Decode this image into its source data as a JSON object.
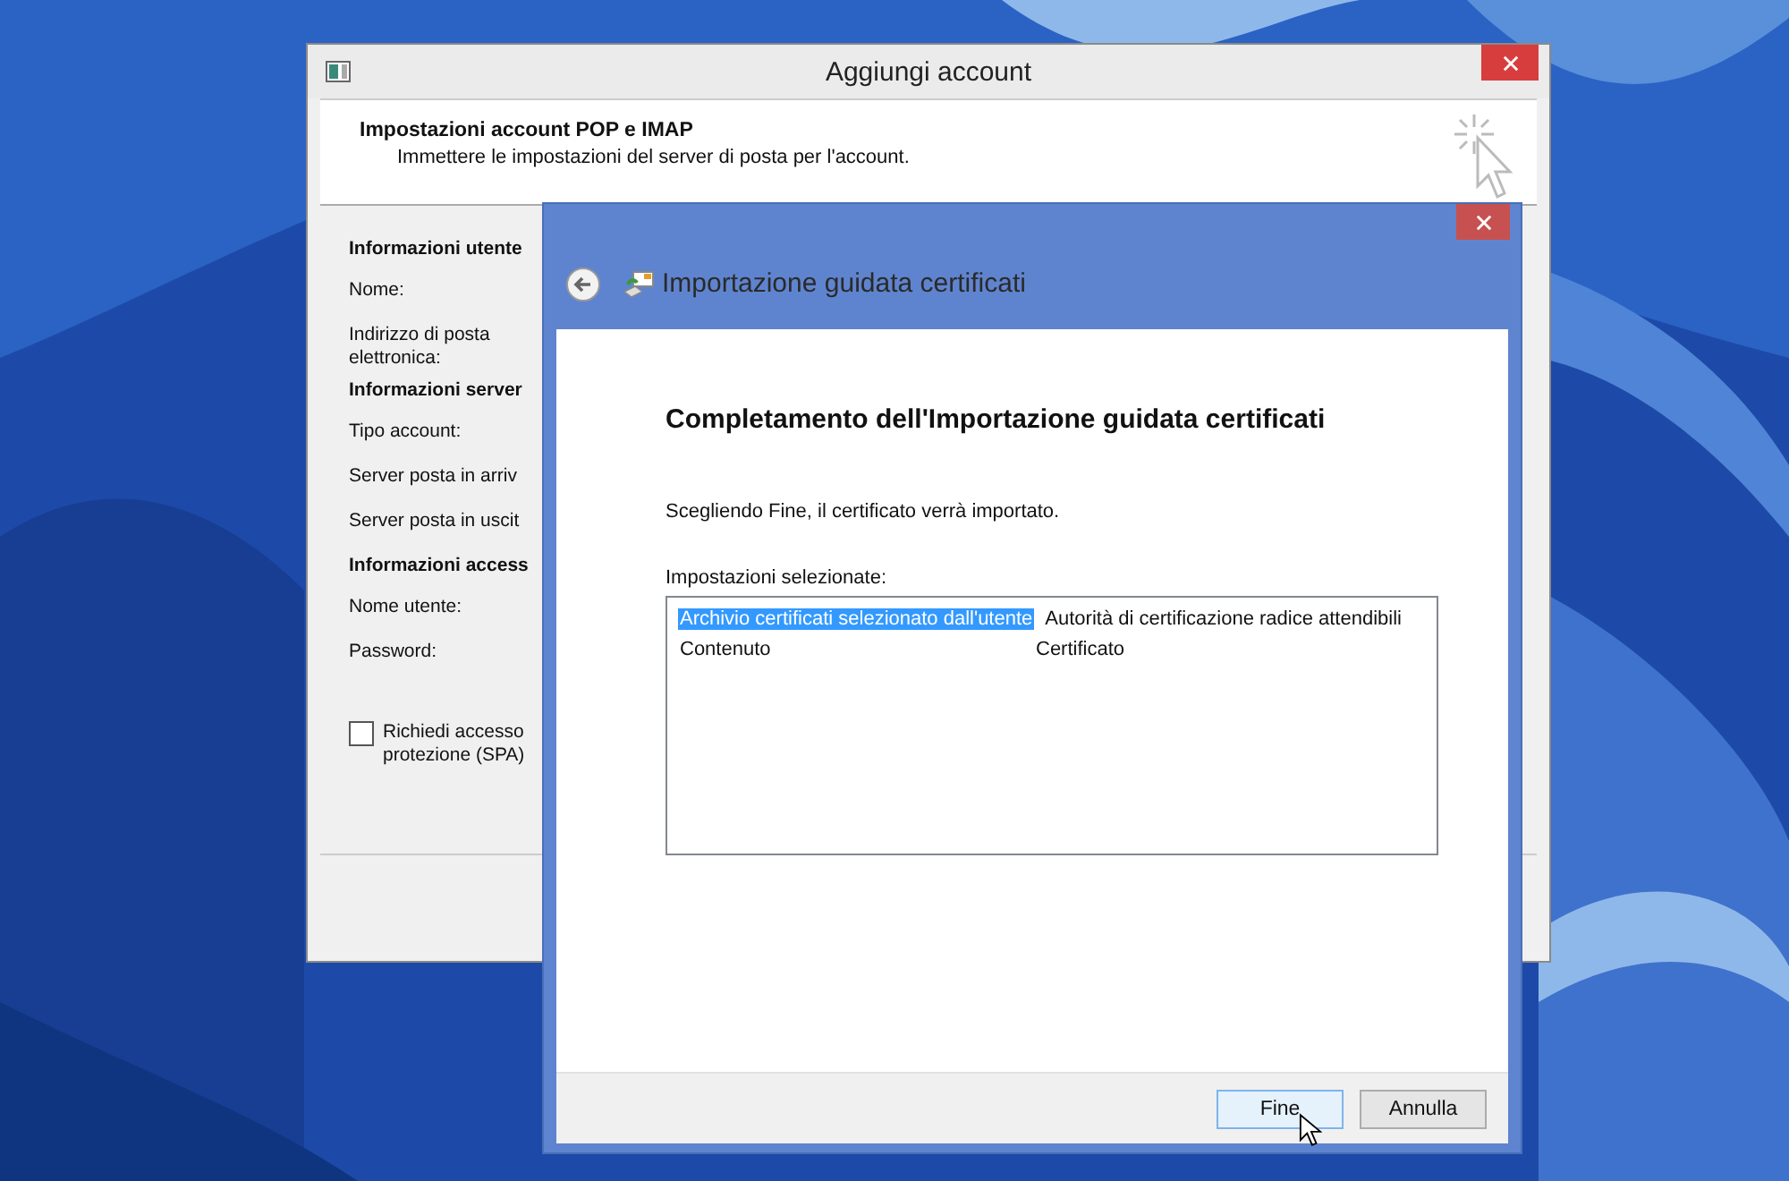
{
  "back_window": {
    "title": "Aggiungi account",
    "header": {
      "title": "Impostazioni account POP e IMAP",
      "subtitle": "Immettere le impostazioni del server di posta per l'account."
    },
    "sections": [
      {
        "heading": "Informazioni utente",
        "fields": [
          "Nome:",
          "Indirizzo di posta elettronica:"
        ]
      },
      {
        "heading": "Informazioni server",
        "fields": [
          "Tipo account:",
          "Server posta in arriv",
          "Server posta in uscit"
        ]
      },
      {
        "heading": "Informazioni access",
        "fields": [
          "Nome utente:",
          "Password:"
        ]
      }
    ],
    "checkbox": {
      "label": "Richiedi accesso protezione (SPA)",
      "checked": false
    }
  },
  "wizard": {
    "title": "Importazione guidata certificati",
    "heading": "Completamento dell'Importazione guidata certificati",
    "message": "Scegliendo Fine, il certificato verrà importato.",
    "list_label": "Impostazioni selezionate:",
    "settings": [
      {
        "name": "Archivio certificati selezionato dall'utente",
        "value": "Autorità di certificazione radice attendibili",
        "selected": true
      },
      {
        "name": "Contenuto",
        "value": "Certificato",
        "selected": false
      }
    ],
    "buttons": [
      {
        "label": "Fine",
        "focused": true
      },
      {
        "label": "Annulla",
        "focused": false
      }
    ]
  }
}
